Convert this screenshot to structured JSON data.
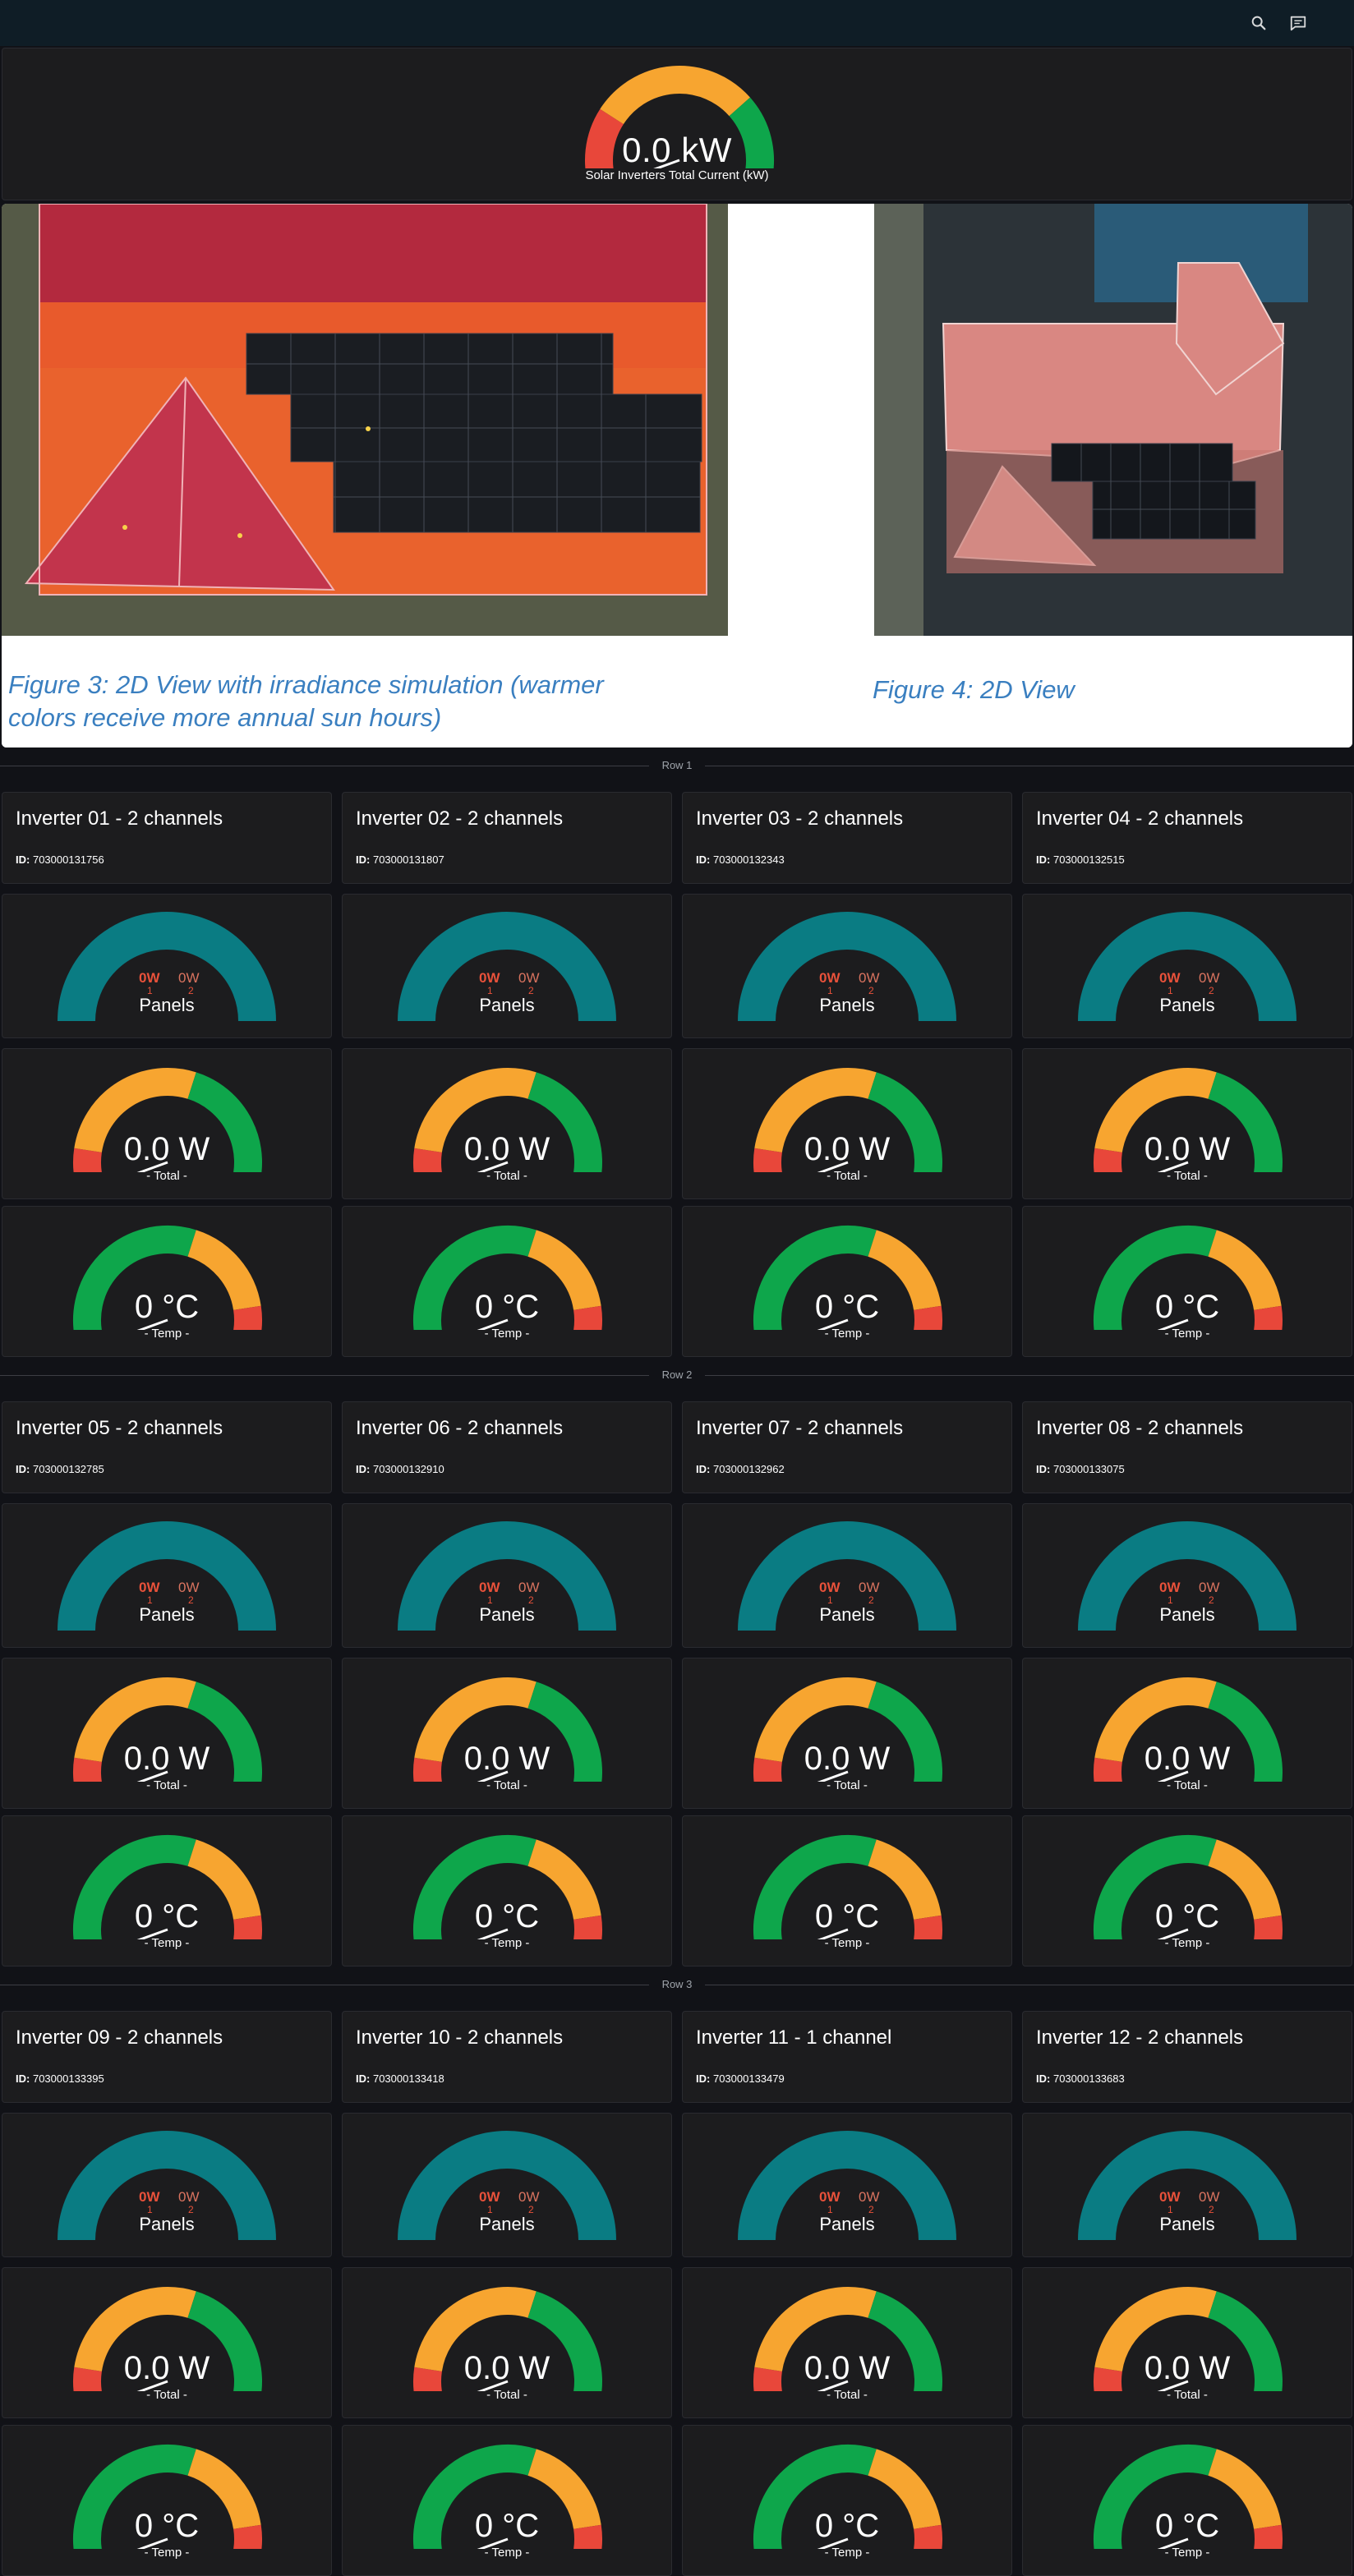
{
  "toolbar": {
    "icons": [
      "search-icon",
      "comment-icon"
    ]
  },
  "total": {
    "value": "0.0 kW",
    "label": "Solar Inverters Total Current (kW)",
    "level": 0,
    "colors": [
      "#e8473a",
      "#f7a530",
      "#0ea64b"
    ]
  },
  "figures": {
    "left_caption": "Figure 3:  2D View with irradiance simulation (warmer colors receive more annual sun hours)",
    "right_caption": "Figure 4:  2D View"
  },
  "rows": [
    {
      "label": "Row 1",
      "inverters": [
        {
          "title": "Inverter 01 - 2 channels",
          "id_label": "ID:",
          "id": "703000131756",
          "channels": [
            "0W",
            "0W"
          ],
          "channel_nums": [
            "1",
            "2"
          ],
          "panels_label": "Panels",
          "total_value": "0.0 W",
          "total_label": "- Total -",
          "temp_value": "0 °C",
          "temp_label": "- Temp -"
        },
        {
          "title": "Inverter 02 - 2 channels",
          "id_label": "ID:",
          "id": "703000131807",
          "channels": [
            "0W",
            "0W"
          ],
          "channel_nums": [
            "1",
            "2"
          ],
          "panels_label": "Panels",
          "total_value": "0.0 W",
          "total_label": "- Total -",
          "temp_value": "0 °C",
          "temp_label": "- Temp -"
        },
        {
          "title": "Inverter 03 - 2 channels",
          "id_label": "ID:",
          "id": "703000132343",
          "channels": [
            "0W",
            "0W"
          ],
          "channel_nums": [
            "1",
            "2"
          ],
          "panels_label": "Panels",
          "total_value": "0.0 W",
          "total_label": "- Total -",
          "temp_value": "0 °C",
          "temp_label": "- Temp -"
        },
        {
          "title": "Inverter 04 - 2 channels",
          "id_label": "ID:",
          "id": "703000132515",
          "channels": [
            "0W",
            "0W"
          ],
          "channel_nums": [
            "1",
            "2"
          ],
          "panels_label": "Panels",
          "total_value": "0.0 W",
          "total_label": "- Total -",
          "temp_value": "0 °C",
          "temp_label": "- Temp -"
        }
      ]
    },
    {
      "label": "Row 2",
      "inverters": [
        {
          "title": "Inverter 05 - 2 channels",
          "id_label": "ID:",
          "id": "703000132785",
          "channels": [
            "0W",
            "0W"
          ],
          "channel_nums": [
            "1",
            "2"
          ],
          "panels_label": "Panels",
          "total_value": "0.0 W",
          "total_label": "- Total -",
          "temp_value": "0 °C",
          "temp_label": "- Temp -"
        },
        {
          "title": "Inverter 06 - 2 channels",
          "id_label": "ID:",
          "id": "703000132910",
          "channels": [
            "0W",
            "0W"
          ],
          "channel_nums": [
            "1",
            "2"
          ],
          "panels_label": "Panels",
          "total_value": "0.0 W",
          "total_label": "- Total -",
          "temp_value": "0 °C",
          "temp_label": "- Temp -"
        },
        {
          "title": "Inverter 07 - 2 channels",
          "id_label": "ID:",
          "id": "703000132962",
          "channels": [
            "0W",
            "0W"
          ],
          "channel_nums": [
            "1",
            "2"
          ],
          "panels_label": "Panels",
          "total_value": "0.0 W",
          "total_label": "- Total -",
          "temp_value": "0 °C",
          "temp_label": "- Temp -"
        },
        {
          "title": "Inverter 08 - 2 channels",
          "id_label": "ID:",
          "id": "703000133075",
          "channels": [
            "0W",
            "0W"
          ],
          "channel_nums": [
            "1",
            "2"
          ],
          "panels_label": "Panels",
          "total_value": "0.0 W",
          "total_label": "- Total -",
          "temp_value": "0 °C",
          "temp_label": "- Temp -"
        }
      ]
    },
    {
      "label": "Row 3",
      "inverters": [
        {
          "title": "Inverter 09 - 2 channels",
          "id_label": "ID:",
          "id": "703000133395",
          "channels": [
            "0W",
            "0W"
          ],
          "channel_nums": [
            "1",
            "2"
          ],
          "panels_label": "Panels",
          "total_value": "0.0 W",
          "total_label": "- Total -",
          "temp_value": "0 °C",
          "temp_label": "- Temp -"
        },
        {
          "title": "Inverter 10 - 2 channels",
          "id_label": "ID:",
          "id": "703000133418",
          "channels": [
            "0W",
            "0W"
          ],
          "channel_nums": [
            "1",
            "2"
          ],
          "panels_label": "Panels",
          "total_value": "0.0 W",
          "total_label": "- Total -",
          "temp_value": "0 °C",
          "temp_label": "- Temp -"
        },
        {
          "title": "Inverter 11 - 1 channel",
          "id_label": "ID:",
          "id": "703000133479",
          "channels": [
            "0W",
            "0W"
          ],
          "channel_nums": [
            "1",
            "2"
          ],
          "panels_label": "Panels",
          "total_value": "0.0 W",
          "total_label": "- Total -",
          "temp_value": "0 °C",
          "temp_label": "- Temp -"
        },
        {
          "title": "Inverter 12 - 2 channels",
          "id_label": "ID:",
          "id": "703000133683",
          "channels": [
            "0W",
            "0W"
          ],
          "channel_nums": [
            "1",
            "2"
          ],
          "panels_label": "Panels",
          "total_value": "0.0 W",
          "total_label": "- Total -",
          "temp_value": "0 °C",
          "temp_label": "- Temp -"
        }
      ]
    }
  ],
  "colors": {
    "panels_arc": "#0a7c83",
    "red": "#e8473a",
    "orange": "#f7a530",
    "green": "#0ea64b"
  }
}
